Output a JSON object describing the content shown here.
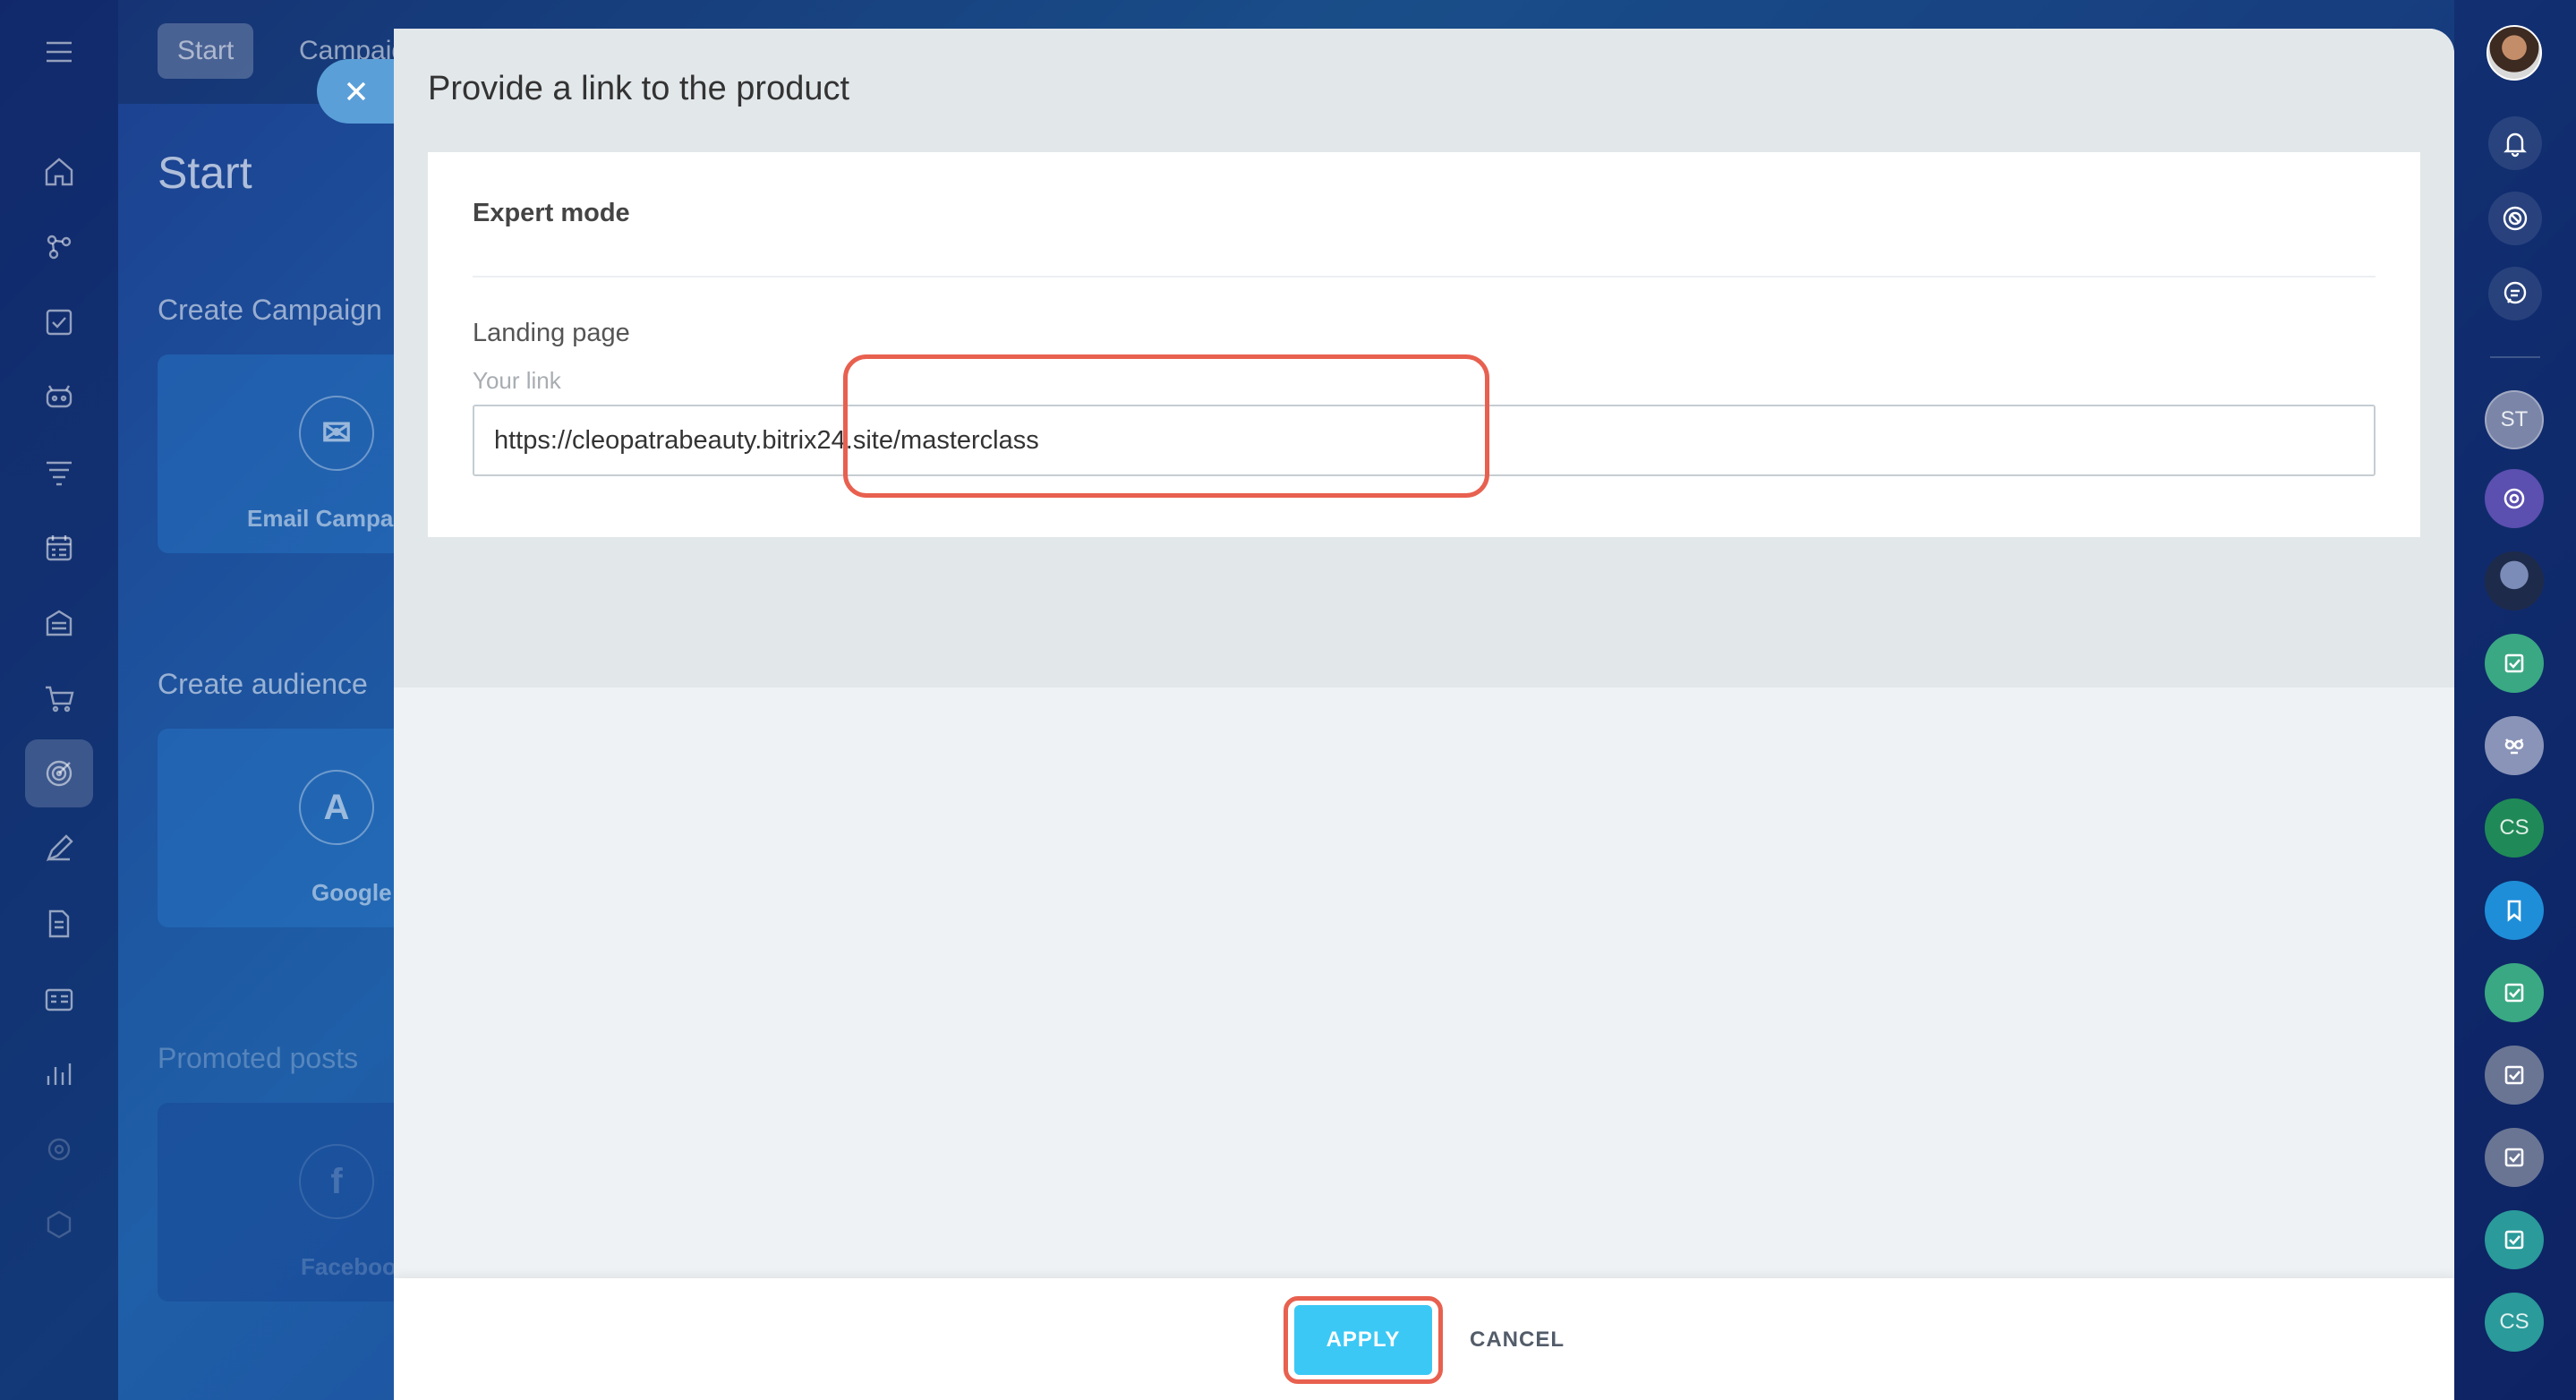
{
  "background": {
    "tabs": [
      "Start",
      "Campaign"
    ],
    "page_title": "Start",
    "sections": [
      "Create Campaign",
      "Create audience",
      "Promoted posts"
    ],
    "cards": [
      "Email Campa",
      "Google Ads",
      "Facebook a"
    ]
  },
  "panel": {
    "title": "Provide a link to the product",
    "card_title": "Expert mode",
    "field_label": "Landing page",
    "field_sublabel": "Your link",
    "link_value": "https://cleopatrabeauty.bitrix24.site/masterclass",
    "apply_label": "APPLY",
    "cancel_label": "CANCEL"
  },
  "rightbar": {
    "chat_initials": [
      "ST",
      "CS",
      "CS"
    ]
  },
  "colors": {
    "apply_button": "#3bc8f5",
    "highlight": "#e8604f"
  }
}
